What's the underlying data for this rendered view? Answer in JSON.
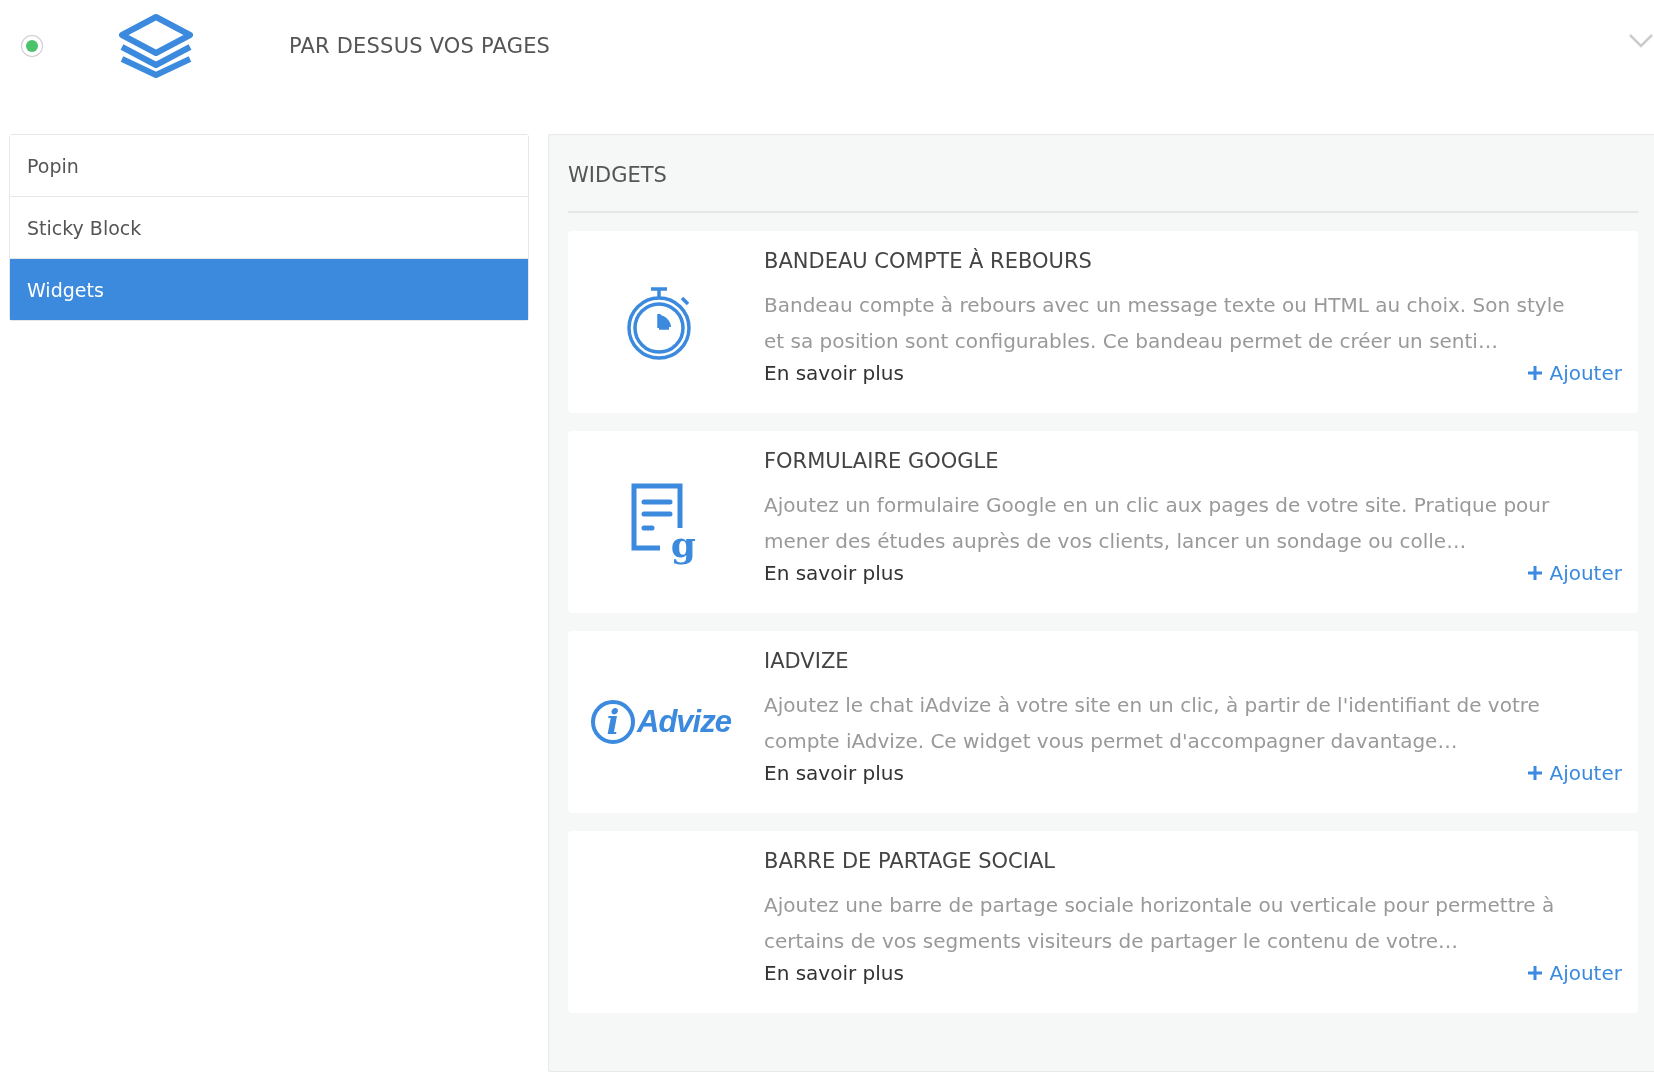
{
  "header": {
    "online": true,
    "title": "PAR DESSUS VOS PAGES",
    "expanded": true
  },
  "sidebar": {
    "items": [
      {
        "label": "Popin",
        "selected": false
      },
      {
        "label": "Sticky Block",
        "selected": false
      },
      {
        "label": "Widgets",
        "selected": true
      }
    ]
  },
  "panel": {
    "title": "WIDGETS",
    "widgets": [
      {
        "kind": "stopwatch",
        "title": "BANDEAU COMPTE À REBOURS",
        "description": "Bandeau compte à rebours avec un message texte ou HTML au choix. Son style et sa position sont configurables. Ce bandeau permet de créer un senti…",
        "more": "En savoir plus",
        "add": "Ajouter"
      },
      {
        "kind": "form",
        "mark": "g",
        "title": "FORMULAIRE GOOGLE",
        "description": "Ajoutez un formulaire Google en un clic aux pages de votre site. Pratique pour mener des études auprès de vos clients, lancer un sondage ou colle…",
        "more": "En savoir plus",
        "add": "Ajouter"
      },
      {
        "kind": "logo",
        "logo": {
          "mark": "i",
          "word": "Advize"
        },
        "title": "IADVIZE",
        "description": "Ajoutez le chat iAdvize à votre site en un clic, à partir de l'identifiant de votre compte iAdvize. Ce widget vous permet d'accompagner davantage…",
        "more": "En savoir plus",
        "add": "Ajouter"
      },
      {
        "kind": "none",
        "title": "BARRE DE PARTAGE SOCIAL",
        "description": "Ajoutez une barre de partage sociale horizontale ou verticale pour permettre à certains de vos segments visiteurs de partager le contenu de votre…",
        "more": "En savoir plus",
        "add": "Ajouter"
      }
    ]
  }
}
